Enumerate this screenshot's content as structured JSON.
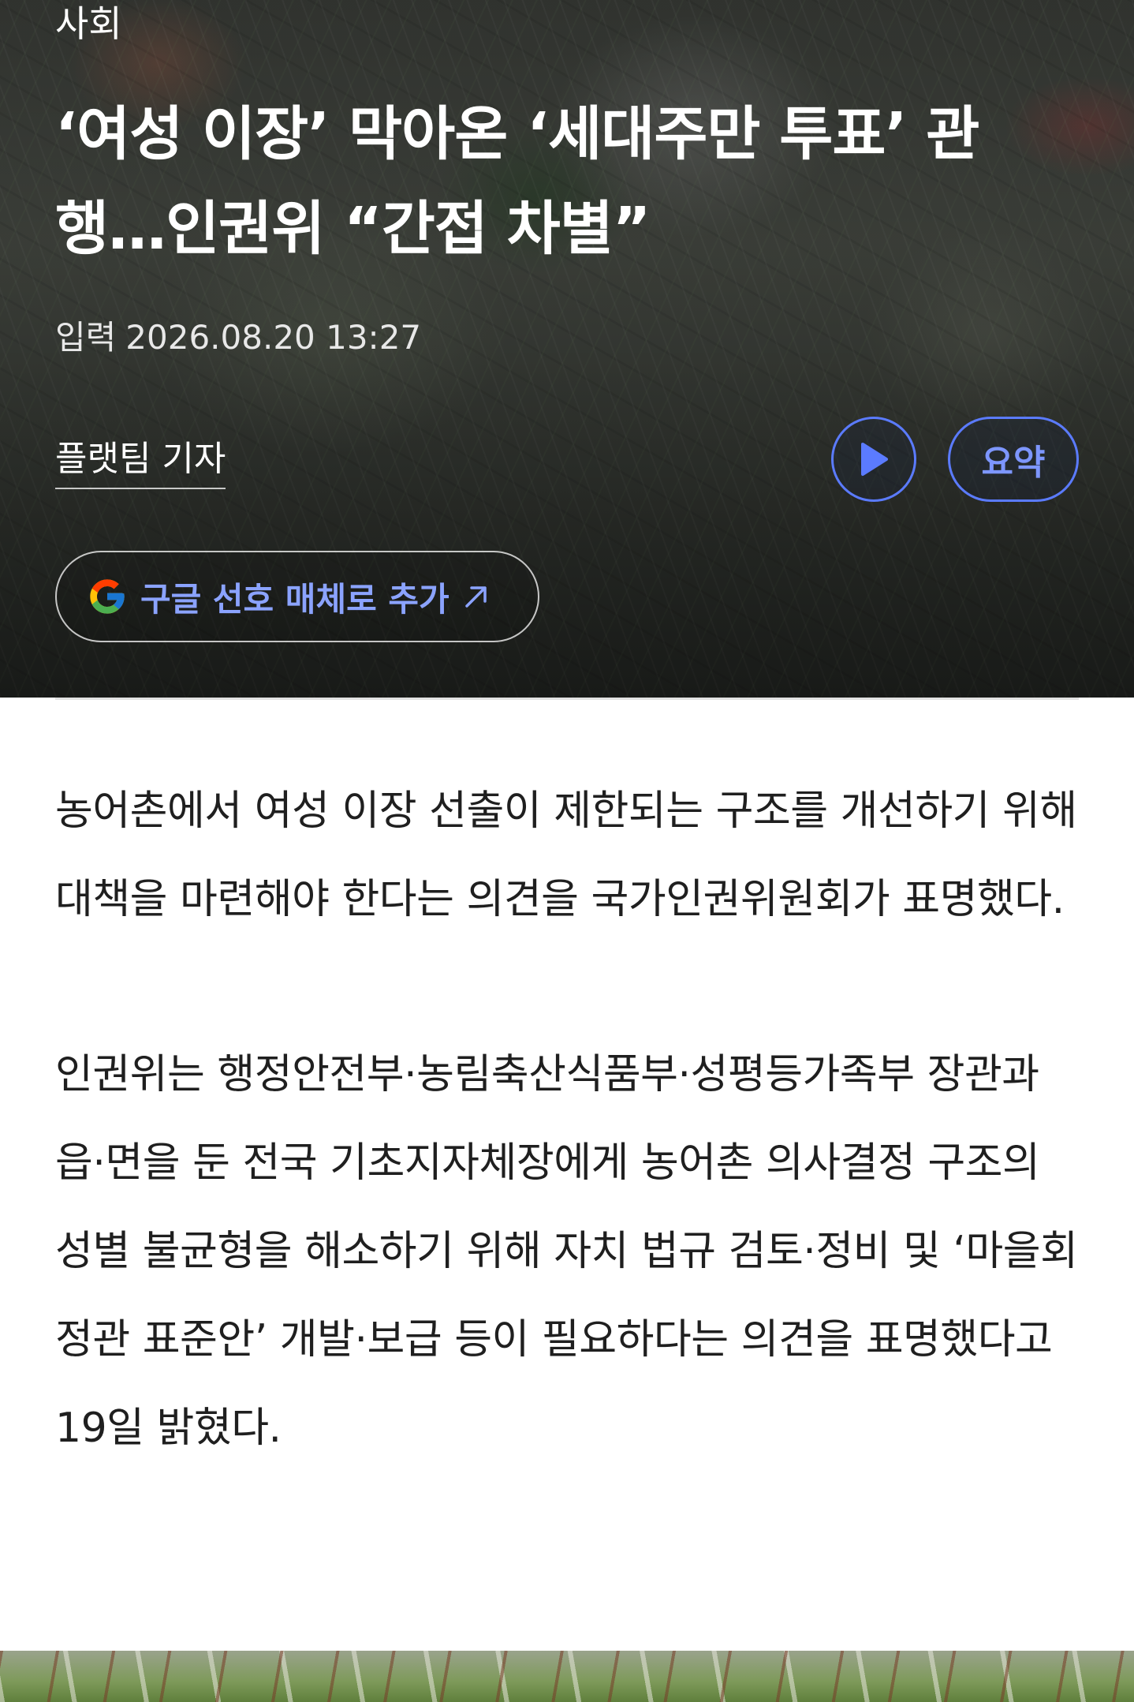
{
  "article": {
    "category": "사회",
    "headline": "‘여성 이장’ 막아온 ‘세대주만 투표’ 관행…인권위 “간접 차별”",
    "timestamp_label": "입력",
    "timestamp_value": "2026.08.20 13:27",
    "reporter": "플랫팀 기자",
    "paragraphs": [
      "농어촌에서 여성 이장 선출이 제한되는 구조를 개선하기 위해 대책을 마련해야 한다는 의견을 국가인권위원회가 표명했다.",
      "인권위는 행정안전부·농림축산식품부·성평등가족부 장관과 읍·면을 둔 전국 기초지자체장에게 농어촌 의사결정 구조의 성별 불균형을 해소하기 위해 자치 법규 검토·정비 및 ‘마을회 정관 표준안’ 개발·보급 등이 필요하다는 의견을 표명했다고 19일 밝혔다."
    ]
  },
  "actions": {
    "summary_label": "요약",
    "google_pill_label": "구글 선호 매체로 추가"
  },
  "icons": {
    "play": "play-icon",
    "google": "google-logo-icon",
    "external": "arrow-up-right-icon"
  },
  "colors": {
    "accent": "#5b7bff",
    "accent_text": "#7d96ff",
    "body_text": "#1f1f1f",
    "hero_text": "#ffffff"
  }
}
